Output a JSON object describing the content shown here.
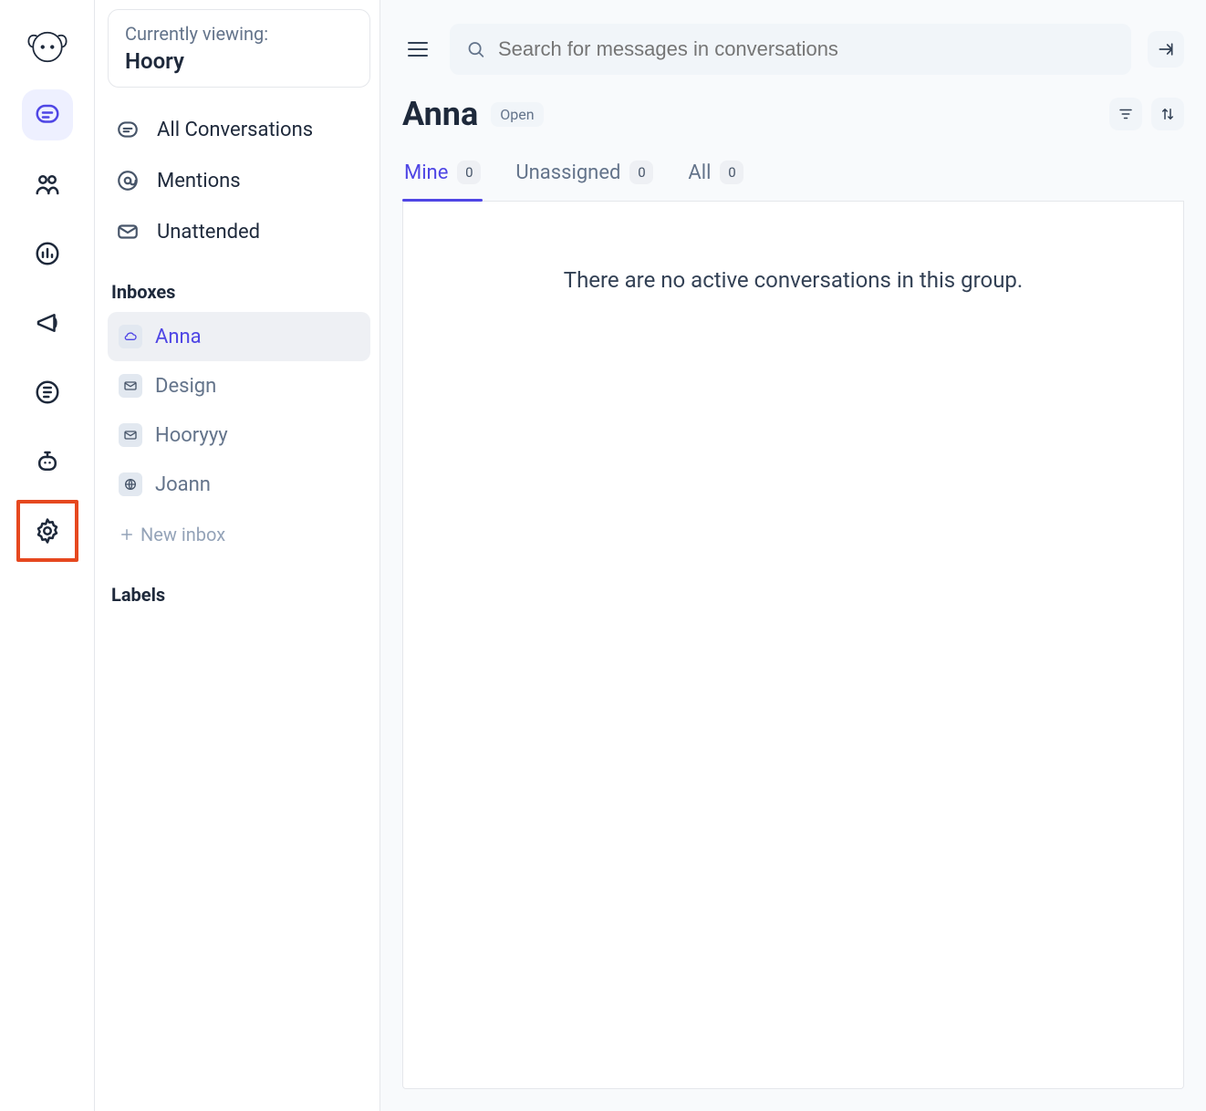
{
  "viewing": {
    "label": "Currently viewing:",
    "value": "Hoory"
  },
  "side_nav": {
    "all_conversations": "All Conversations",
    "mentions": "Mentions",
    "unattended": "Unattended"
  },
  "inboxes": {
    "title": "Inboxes",
    "items": [
      {
        "name": "Anna",
        "icon": "cloud",
        "active": true
      },
      {
        "name": "Design",
        "icon": "mail",
        "active": false
      },
      {
        "name": "Hooryyy",
        "icon": "mail",
        "active": false
      },
      {
        "name": "Joann",
        "icon": "globe",
        "active": false
      }
    ],
    "new_label": "New inbox"
  },
  "labels": {
    "title": "Labels"
  },
  "search": {
    "placeholder": "Search for messages in conversations"
  },
  "page": {
    "title": "Anna",
    "status": "Open"
  },
  "tabs": [
    {
      "label": "Mine",
      "count": "0",
      "active": true
    },
    {
      "label": "Unassigned",
      "count": "0",
      "active": false
    },
    {
      "label": "All",
      "count": "0",
      "active": false
    }
  ],
  "empty_state": "There are no active conversations in this group."
}
